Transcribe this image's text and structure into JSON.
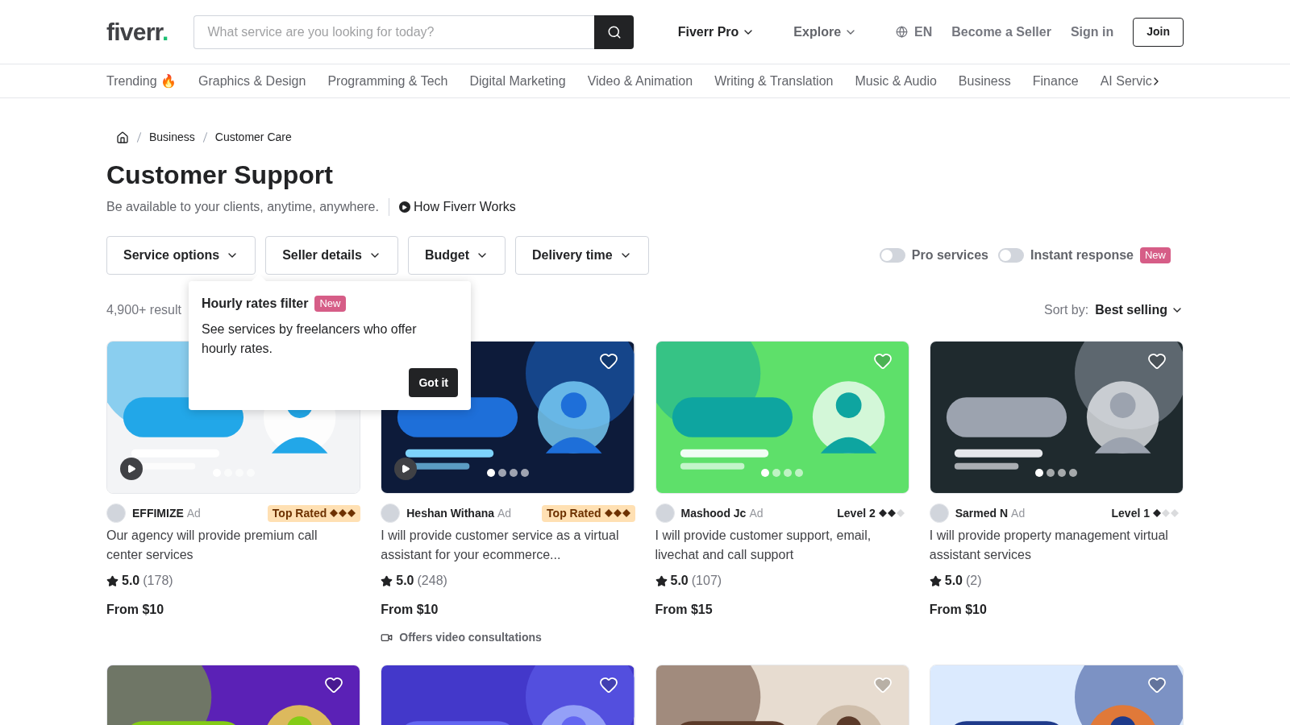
{
  "header": {
    "logo": "fiverr",
    "logo_dot": ".",
    "search": {
      "placeholder": "What service are you looking for today?"
    },
    "nav": [
      {
        "label": "Fiverr Pro",
        "kind": "dropdown"
      },
      {
        "label": "Explore",
        "kind": "dropdown"
      },
      {
        "label": "EN",
        "kind": "language"
      },
      {
        "label": "Become a Seller",
        "kind": "link"
      },
      {
        "label": "Sign in",
        "kind": "link"
      },
      {
        "label": "Join",
        "kind": "button"
      }
    ]
  },
  "categories": [
    "Trending 🔥",
    "Graphics & Design",
    "Programming & Tech",
    "Digital Marketing",
    "Video & Animation",
    "Writing & Translation",
    "Music & Audio",
    "Business",
    "Finance",
    "AI Servic"
  ],
  "breadcrumb": [
    "Business",
    "Customer Care"
  ],
  "title": "Customer Support",
  "subtitle": "Be available to your clients, anytime, anywhere.",
  "how_link": "How Fiverr Works",
  "filters": [
    "Service options",
    "Seller details",
    "Budget",
    "Delivery time"
  ],
  "toggles": [
    {
      "label": "Pro services",
      "on": false
    },
    {
      "label": "Instant response",
      "on": false,
      "badge": "New"
    }
  ],
  "tooltip": {
    "title": "Hourly rates filter",
    "badge": "New",
    "text": "See services by freelancers who offer hourly rates.",
    "button": "Got it"
  },
  "results": "4,900+ result",
  "sort": {
    "label": "Sort by:",
    "value": "Best selling"
  },
  "gigs": [
    {
      "seller": "EFFIMIZE",
      "ad": "Ad",
      "badge": "Top Rated",
      "kind": "top",
      "stars": 3,
      "title": "Our agency will provide premium call center services",
      "rating": "5.0",
      "reviews": "(178)",
      "price": "From $10",
      "video": true
    },
    {
      "seller": "Heshan Withana",
      "ad": "Ad",
      "badge": "Top Rated",
      "kind": "top",
      "stars": 3,
      "title": "I will provide customer service as a virtual assistant for your ecommerce...",
      "rating": "5.0",
      "reviews": "(248)",
      "price": "From $10",
      "video": true,
      "favorited": false,
      "extra": "Offers video consultations"
    },
    {
      "seller": "Mashood Jc",
      "ad": "Ad",
      "badge": "Level 2",
      "kind": "level",
      "stars": 2,
      "title": "I will provide customer support, email, livechat and call support",
      "rating": "5.0",
      "reviews": "(107)",
      "price": "From $15",
      "video": false,
      "favorited": false
    },
    {
      "seller": "Sarmed N",
      "ad": "Ad",
      "badge": "Level 1",
      "kind": "level",
      "stars": 1,
      "title": "I will provide property management virtual assistant services",
      "rating": "5.0",
      "reviews": "(2)",
      "price": "From $10",
      "video": false,
      "favorited": false
    }
  ],
  "more_gigs": [
    {
      "favorited": false
    },
    {
      "favorited": false
    },
    {
      "favorited": false
    },
    {
      "favorited": false
    }
  ]
}
